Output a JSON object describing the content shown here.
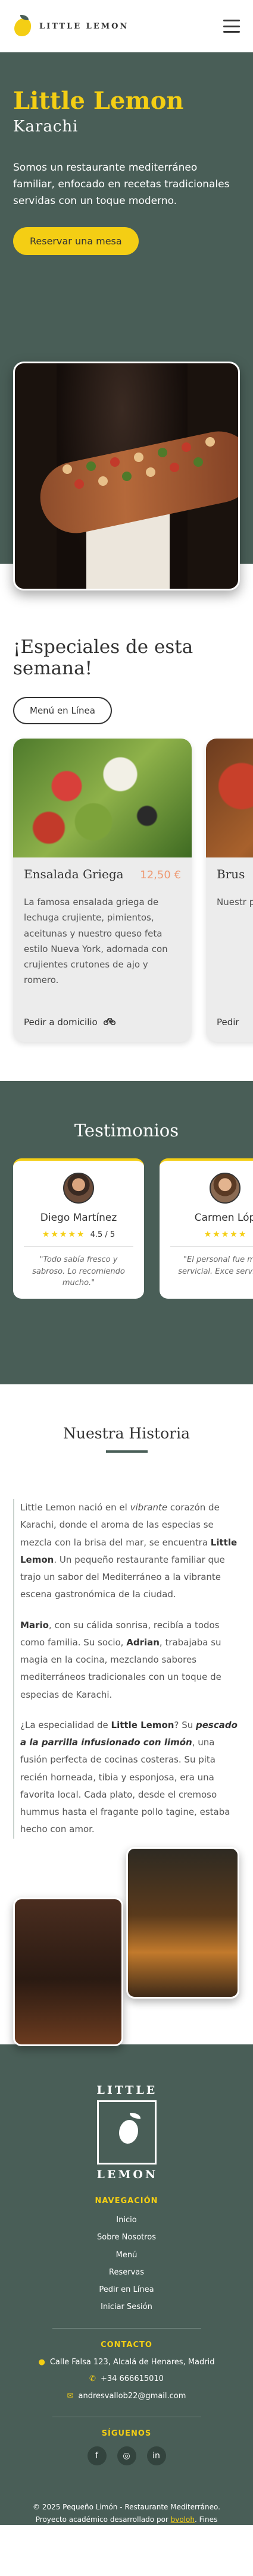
{
  "header": {
    "brand": "LITTLE LEMON",
    "menu_icon": "hamburger-icon"
  },
  "hero": {
    "title": "Little Lemon",
    "subtitle": "Karachi",
    "description": "Somos un restaurante mediterráneo familiar, enfocado en recetas tradicionales servidas con un toque moderno.",
    "cta": "Reservar una mesa"
  },
  "specials": {
    "title": "¡Especiales de esta semana!",
    "cta": "Menú en Línea",
    "cards": [
      {
        "name": "Ensalada Griega",
        "price": "12,50 €",
        "description": "La famosa ensalada griega de lechuga crujiente, pimientos, aceitunas y nuestro queso feta estilo Nueva York, adornada con crujientes crutones de ajo y romero.",
        "action": "Pedir a domicilio",
        "action_icon": "bicycle-icon"
      },
      {
        "name": "Brus",
        "price": "",
        "description": "Nuestr pan a la con aji de oliv",
        "action": "Pedir",
        "action_icon": "bicycle-icon"
      }
    ]
  },
  "testimonials": {
    "title": "Testimonios",
    "items": [
      {
        "name": "Diego Martínez",
        "stars": 4.5,
        "score": "4.5 / 5",
        "quote": "\"Todo sabía fresco y sabroso. Lo recomiendo mucho.\""
      },
      {
        "name": "Carmen Lóp",
        "stars": 5,
        "score": "",
        "quote": "\"El personal fue mu y servicial. Exce servicio.\""
      }
    ]
  },
  "history": {
    "title": "Nuestra Historia",
    "p1_a": "Little Lemon nació en el ",
    "p1_b": "vibrante",
    "p1_c": " corazón de Karachi, donde el aroma de las especias se mezcla con la brisa del mar, se encuentra ",
    "p1_d": "Little Lemon",
    "p1_e": ". Un pequeño restaurante familiar que trajo un sabor del Mediterráneo a la vibrante escena gastronómica de la ciudad.",
    "p2_a": "Mario",
    "p2_b": ", con su cálida sonrisa, recibía a todos como familia. Su socio, ",
    "p2_c": "Adrian",
    "p2_d": ", trabajaba su magia en la cocina, mezclando sabores mediterráneos tradicionales con un toque de especias de Karachi.",
    "p3_a": "¿La especialidad de ",
    "p3_b": "Little Lemon",
    "p3_c": "? Su ",
    "p3_d": "pescado a la parrilla infusionado con limón",
    "p3_e": ", una fusión perfecta de cocinas costeras. Su pita recién horneada, tibia y esponjosa, era una favorita local. Cada plato, desde el cremoso hummus hasta el fragante pollo tagine, estaba hecho con amor."
  },
  "footer": {
    "logo_top": "LITTLE",
    "logo_bottom": "LEMON",
    "nav_title": "NAVEGACIÓN",
    "nav": [
      "Inicio",
      "Sobre Nosotros",
      "Menú",
      "Reservas",
      "Pedir en Línea",
      "Iniciar Sesión"
    ],
    "contact_title": "CONTACTO",
    "address": "Calle Falsa 123, Alcalá de Henares, Madrid",
    "phone": "+34 666615010",
    "email": "andresvallob22@gmail.com",
    "follow_title": "SÍGUENOS",
    "socials": [
      "facebook-icon",
      "instagram-icon",
      "linkedin-icon"
    ],
    "copyright_a": "© 2025 Pequeño Limón - Restaurante Mediterráneo. Proyecto académico desarrollado por ",
    "copyright_link": "bvoloh",
    "copyright_b": ". Fines educativos únicamente."
  },
  "colors": {
    "primary_green": "#495e57",
    "primary_yellow": "#f4ce14",
    "salmon": "#ee9972"
  }
}
